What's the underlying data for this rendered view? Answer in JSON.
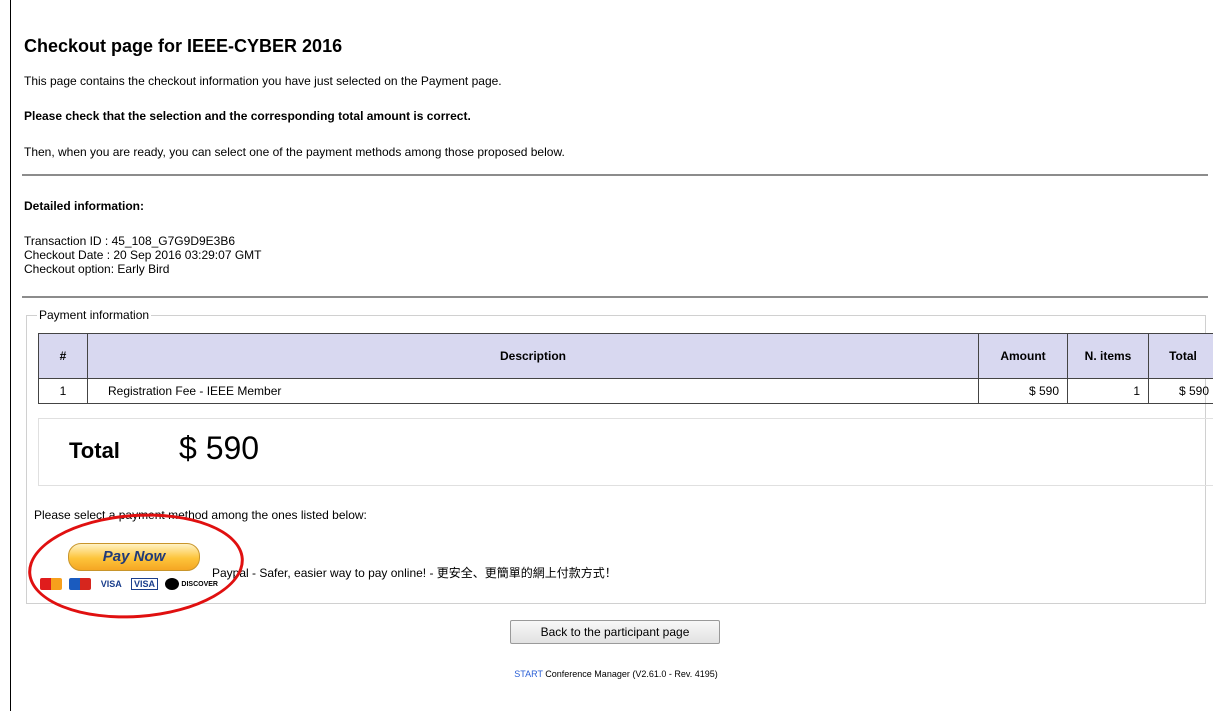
{
  "page": {
    "title": "Checkout page for IEEE-CYBER 2016",
    "intro": "This page contains the checkout information you have just selected on the Payment page.",
    "check_notice": "Please check that the selection and the corresponding total amount is correct.",
    "ready_notice": "Then, when you are ready, you can select one of the payment methods among those proposed below."
  },
  "details": {
    "heading": "Detailed information:",
    "transaction": "Transaction ID : 45_108_G7G9D9E3B6",
    "date": "Checkout Date : 20 Sep 2016 03:29:07 GMT",
    "option": "Checkout option: Early Bird"
  },
  "payment": {
    "legend": "Payment information",
    "columns": {
      "num": "#",
      "description": "Description",
      "amount": "Amount",
      "n_items": "N. items",
      "total": "Total"
    },
    "rows": [
      {
        "num": "1",
        "description": "Registration Fee - IEEE Member",
        "amount": "$ 590",
        "n_items": "1",
        "total": "$ 590"
      }
    ],
    "total_label": "Total",
    "total_value": "$ 590",
    "select_text": "Please select a payment method among the ones listed below:",
    "paypal": {
      "button_label": "Pay Now",
      "description": "Paypal - Safer, easier way to pay online! - 更安全、更簡單的網上付款方式！",
      "cards": [
        "mastercard",
        "maestro",
        "VISA",
        "VISA",
        "DISCOVER"
      ],
      "annotation_color": "#e01010"
    }
  },
  "actions": {
    "back_label": "Back to the participant page"
  },
  "footer": {
    "brand": "START",
    "text": " Conference Manager (V2.61.0 - Rev. 4195)"
  }
}
